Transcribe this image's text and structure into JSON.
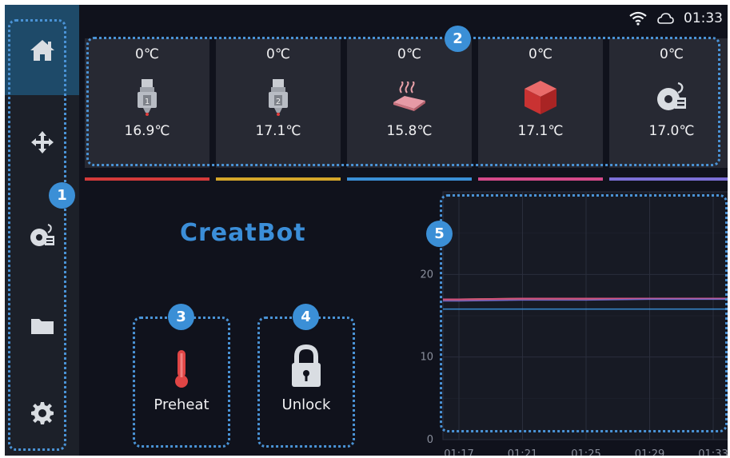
{
  "status": {
    "time": "01:33",
    "wifi_icon": "wifi-icon",
    "cloud_icon": "cloud-icon"
  },
  "sidebar": {
    "items": [
      {
        "icon": "home-icon",
        "active": true
      },
      {
        "icon": "move-icon",
        "active": false
      },
      {
        "icon": "filament-icon",
        "active": false
      },
      {
        "icon": "folder-icon",
        "active": false
      },
      {
        "icon": "gear-icon",
        "active": false
      }
    ]
  },
  "tiles": [
    {
      "id": "extruder-1",
      "target": "0℃",
      "current": "16.9℃",
      "icon": "extruder-1-icon",
      "color": "#d33a3a"
    },
    {
      "id": "extruder-2",
      "target": "0℃",
      "current": "17.1℃",
      "icon": "extruder-2-icon",
      "color": "#d4a62a"
    },
    {
      "id": "bed",
      "target": "0℃",
      "current": "15.8℃",
      "icon": "heated-bed-icon",
      "color": "#3a8fd6"
    },
    {
      "id": "chamber",
      "target": "0℃",
      "current": "17.1℃",
      "icon": "chamber-icon",
      "color": "#d44a8a"
    },
    {
      "id": "filament",
      "target": "0℃",
      "current": "17.0℃",
      "icon": "filament-dryer-icon",
      "color": "#7b6fd6"
    }
  ],
  "brand": {
    "logo": "CreatBot",
    "color": "#3b8ed8"
  },
  "actions": {
    "preheat_label": "Preheat",
    "unlock_label": "Unlock"
  },
  "annotations": [
    "1",
    "2",
    "3",
    "4",
    "5"
  ],
  "chart_data": {
    "type": "line",
    "x": [
      "01:17",
      "01:21",
      "01:25",
      "01:29",
      "01:33"
    ],
    "ytick_labels": [
      "0",
      "10",
      "20"
    ],
    "ylim": [
      0,
      30
    ],
    "grid": true,
    "series": [
      {
        "values": [
          16.9,
          17.0,
          17.0,
          17.1,
          17.1
        ],
        "color": "#d33a3a"
      },
      {
        "values": [
          17.0,
          17.1,
          17.1,
          17.1,
          17.1
        ],
        "color": "#d4a62a"
      },
      {
        "values": [
          15.8,
          15.8,
          15.8,
          15.8,
          15.8
        ],
        "color": "#3a8fd6"
      },
      {
        "values": [
          17.0,
          17.1,
          17.1,
          17.1,
          17.1
        ],
        "color": "#d44a8a"
      },
      {
        "values": [
          16.8,
          16.9,
          16.9,
          17.0,
          17.0
        ],
        "color": "#7b6fd6"
      }
    ]
  }
}
